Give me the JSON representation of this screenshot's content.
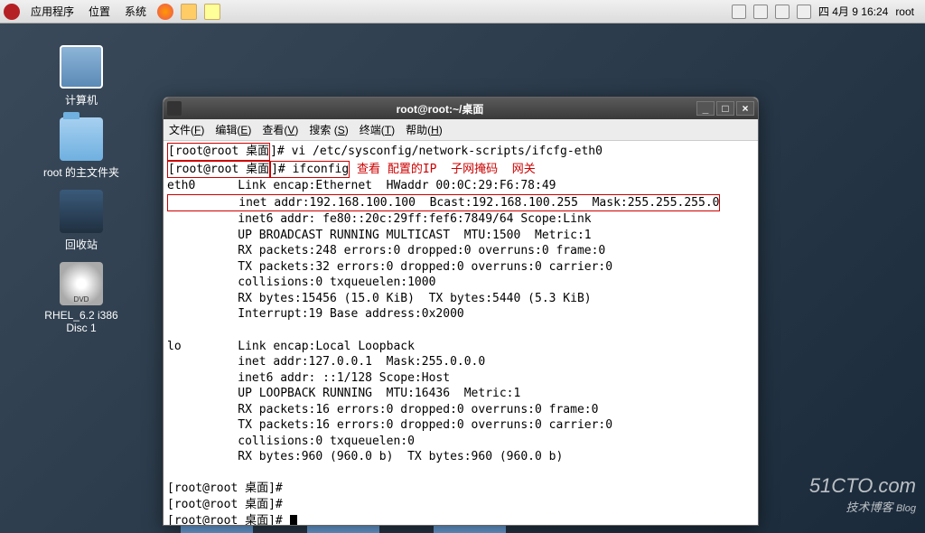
{
  "panel": {
    "apps": "应用程序",
    "places": "位置",
    "system": "系统",
    "datetime": "四 4月  9 16:24",
    "user": "root"
  },
  "desktop": {
    "computer": "计算机",
    "home": "root 的主文件夹",
    "trash": "回收站",
    "disc": "RHEL_6.2 i386 Disc 1"
  },
  "terminal": {
    "title": "root@root:~/桌面",
    "menu": {
      "file": "文件(F)",
      "edit": "编辑(E)",
      "view": "查看(V)",
      "search": "搜索 (S)",
      "term": "终端(T)",
      "help": "帮助(H)"
    },
    "prompt1_pre": "[root@root 桌面",
    "prompt1_post": "]# vi /etc/sysconfig/network-scripts/ifcfg-eth0",
    "prompt2_pre": "[root@root 桌面",
    "prompt2_cmd": "]# ifconfig",
    "annotation": " 查看 配置的IP  子网掩码  网关",
    "eth0_line": "eth0      Link encap:Ethernet  HWaddr 00:0C:29:F6:78:49",
    "eth0_inet": "          inet addr:192.168.100.100  Bcast:192.168.100.255  Mask:255.255.255.0",
    "eth0_rest": "          inet6 addr: fe80::20c:29ff:fef6:7849/64 Scope:Link\n          UP BROADCAST RUNNING MULTICAST  MTU:1500  Metric:1\n          RX packets:248 errors:0 dropped:0 overruns:0 frame:0\n          TX packets:32 errors:0 dropped:0 overruns:0 carrier:0\n          collisions:0 txqueuelen:1000\n          RX bytes:15456 (15.0 KiB)  TX bytes:5440 (5.3 KiB)\n          Interrupt:19 Base address:0x2000",
    "lo_block": "lo        Link encap:Local Loopback\n          inet addr:127.0.0.1  Mask:255.0.0.0\n          inet6 addr: ::1/128 Scope:Host\n          UP LOOPBACK RUNNING  MTU:16436  Metric:1\n          RX packets:16 errors:0 dropped:0 overruns:0 frame:0\n          TX packets:16 errors:0 dropped:0 overruns:0 carrier:0\n          collisions:0 txqueuelen:0\n          RX bytes:960 (960.0 b)  TX bytes:960 (960.0 b)",
    "prompt_empty": "[root@root 桌面]#",
    "prompt_empty2": "[root@root 桌面]#",
    "prompt_empty3": "[root@root 桌面]# "
  },
  "watermark": {
    "line1": "51CTO.com",
    "line2": "技术博客",
    "line3": "Blog"
  }
}
